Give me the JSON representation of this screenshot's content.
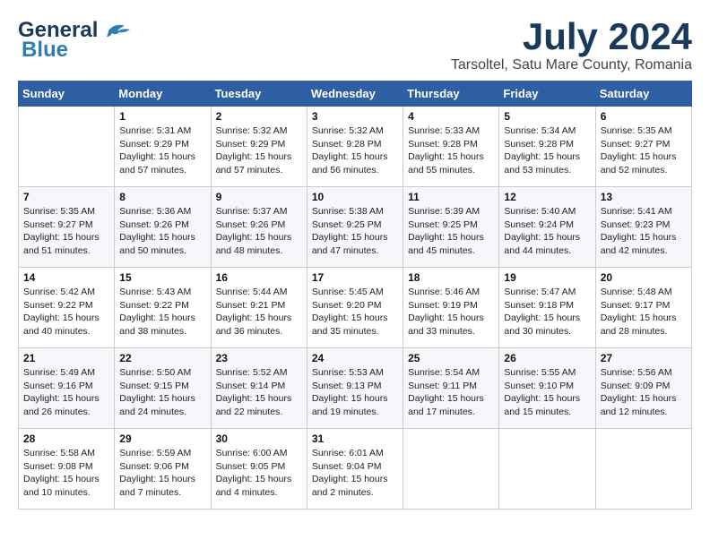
{
  "logo": {
    "line1": "General",
    "line2": "Blue"
  },
  "title": "July 2024",
  "subtitle": "Tarsoltel, Satu Mare County, Romania",
  "weekdays": [
    "Sunday",
    "Monday",
    "Tuesday",
    "Wednesday",
    "Thursday",
    "Friday",
    "Saturday"
  ],
  "weeks": [
    [
      {
        "day": "",
        "info": ""
      },
      {
        "day": "1",
        "info": "Sunrise: 5:31 AM\nSunset: 9:29 PM\nDaylight: 15 hours\nand 57 minutes."
      },
      {
        "day": "2",
        "info": "Sunrise: 5:32 AM\nSunset: 9:29 PM\nDaylight: 15 hours\nand 57 minutes."
      },
      {
        "day": "3",
        "info": "Sunrise: 5:32 AM\nSunset: 9:28 PM\nDaylight: 15 hours\nand 56 minutes."
      },
      {
        "day": "4",
        "info": "Sunrise: 5:33 AM\nSunset: 9:28 PM\nDaylight: 15 hours\nand 55 minutes."
      },
      {
        "day": "5",
        "info": "Sunrise: 5:34 AM\nSunset: 9:28 PM\nDaylight: 15 hours\nand 53 minutes."
      },
      {
        "day": "6",
        "info": "Sunrise: 5:35 AM\nSunset: 9:27 PM\nDaylight: 15 hours\nand 52 minutes."
      }
    ],
    [
      {
        "day": "7",
        "info": "Sunrise: 5:35 AM\nSunset: 9:27 PM\nDaylight: 15 hours\nand 51 minutes."
      },
      {
        "day": "8",
        "info": "Sunrise: 5:36 AM\nSunset: 9:26 PM\nDaylight: 15 hours\nand 50 minutes."
      },
      {
        "day": "9",
        "info": "Sunrise: 5:37 AM\nSunset: 9:26 PM\nDaylight: 15 hours\nand 48 minutes."
      },
      {
        "day": "10",
        "info": "Sunrise: 5:38 AM\nSunset: 9:25 PM\nDaylight: 15 hours\nand 47 minutes."
      },
      {
        "day": "11",
        "info": "Sunrise: 5:39 AM\nSunset: 9:25 PM\nDaylight: 15 hours\nand 45 minutes."
      },
      {
        "day": "12",
        "info": "Sunrise: 5:40 AM\nSunset: 9:24 PM\nDaylight: 15 hours\nand 44 minutes."
      },
      {
        "day": "13",
        "info": "Sunrise: 5:41 AM\nSunset: 9:23 PM\nDaylight: 15 hours\nand 42 minutes."
      }
    ],
    [
      {
        "day": "14",
        "info": "Sunrise: 5:42 AM\nSunset: 9:22 PM\nDaylight: 15 hours\nand 40 minutes."
      },
      {
        "day": "15",
        "info": "Sunrise: 5:43 AM\nSunset: 9:22 PM\nDaylight: 15 hours\nand 38 minutes."
      },
      {
        "day": "16",
        "info": "Sunrise: 5:44 AM\nSunset: 9:21 PM\nDaylight: 15 hours\nand 36 minutes."
      },
      {
        "day": "17",
        "info": "Sunrise: 5:45 AM\nSunset: 9:20 PM\nDaylight: 15 hours\nand 35 minutes."
      },
      {
        "day": "18",
        "info": "Sunrise: 5:46 AM\nSunset: 9:19 PM\nDaylight: 15 hours\nand 33 minutes."
      },
      {
        "day": "19",
        "info": "Sunrise: 5:47 AM\nSunset: 9:18 PM\nDaylight: 15 hours\nand 30 minutes."
      },
      {
        "day": "20",
        "info": "Sunrise: 5:48 AM\nSunset: 9:17 PM\nDaylight: 15 hours\nand 28 minutes."
      }
    ],
    [
      {
        "day": "21",
        "info": "Sunrise: 5:49 AM\nSunset: 9:16 PM\nDaylight: 15 hours\nand 26 minutes."
      },
      {
        "day": "22",
        "info": "Sunrise: 5:50 AM\nSunset: 9:15 PM\nDaylight: 15 hours\nand 24 minutes."
      },
      {
        "day": "23",
        "info": "Sunrise: 5:52 AM\nSunset: 9:14 PM\nDaylight: 15 hours\nand 22 minutes."
      },
      {
        "day": "24",
        "info": "Sunrise: 5:53 AM\nSunset: 9:13 PM\nDaylight: 15 hours\nand 19 minutes."
      },
      {
        "day": "25",
        "info": "Sunrise: 5:54 AM\nSunset: 9:11 PM\nDaylight: 15 hours\nand 17 minutes."
      },
      {
        "day": "26",
        "info": "Sunrise: 5:55 AM\nSunset: 9:10 PM\nDaylight: 15 hours\nand 15 minutes."
      },
      {
        "day": "27",
        "info": "Sunrise: 5:56 AM\nSunset: 9:09 PM\nDaylight: 15 hours\nand 12 minutes."
      }
    ],
    [
      {
        "day": "28",
        "info": "Sunrise: 5:58 AM\nSunset: 9:08 PM\nDaylight: 15 hours\nand 10 minutes."
      },
      {
        "day": "29",
        "info": "Sunrise: 5:59 AM\nSunset: 9:06 PM\nDaylight: 15 hours\nand 7 minutes."
      },
      {
        "day": "30",
        "info": "Sunrise: 6:00 AM\nSunset: 9:05 PM\nDaylight: 15 hours\nand 4 minutes."
      },
      {
        "day": "31",
        "info": "Sunrise: 6:01 AM\nSunset: 9:04 PM\nDaylight: 15 hours\nand 2 minutes."
      },
      {
        "day": "",
        "info": ""
      },
      {
        "day": "",
        "info": ""
      },
      {
        "day": "",
        "info": ""
      }
    ]
  ]
}
